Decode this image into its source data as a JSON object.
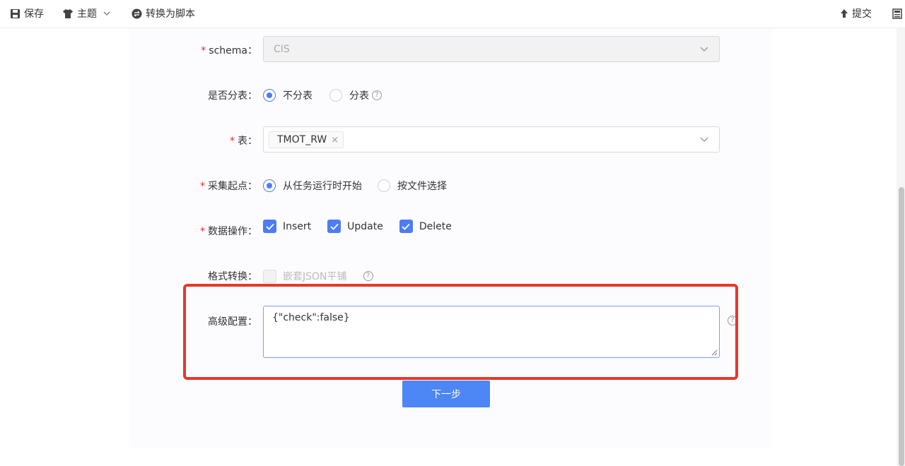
{
  "toolbar": {
    "save_label": "保存",
    "theme_label": "主题",
    "convert_label": "转换为脚本",
    "submit_label": "提交"
  },
  "form": {
    "schema": {
      "label": "schema",
      "required": "*",
      "value": "CIS"
    },
    "sharding": {
      "label": "是否分表",
      "options": [
        "不分表",
        "分表"
      ],
      "selected": "不分表"
    },
    "table": {
      "label": "表",
      "required": "*",
      "tags": [
        "TMOT_RW"
      ]
    },
    "start_point": {
      "label": "采集起点",
      "required": "*",
      "options": [
        "从任务运行时开始",
        "按文件选择"
      ],
      "selected": "从任务运行时开始"
    },
    "data_ops": {
      "label": "数据操作",
      "required": "*",
      "options": [
        "Insert",
        "Update",
        "Delete"
      ],
      "checked": [
        "Insert",
        "Update",
        "Delete"
      ]
    },
    "format": {
      "label": "格式转换",
      "option": "嵌套JSON平铺",
      "checked": false
    },
    "advanced": {
      "label": "高级配置",
      "value": "{\"check\":false}"
    },
    "colon": "："
  },
  "next_label": "下一步",
  "help_glyph": "?",
  "tag_close": "×",
  "colors": {
    "primary": "#4d7cf3",
    "highlight": "#e8372b",
    "required": "#f5222d"
  }
}
